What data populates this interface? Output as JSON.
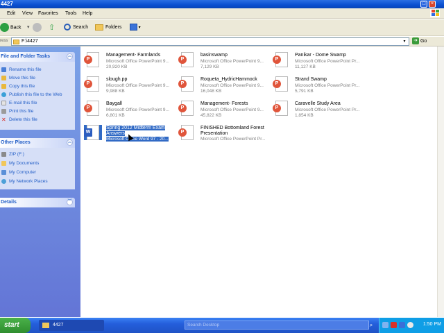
{
  "window": {
    "title": "4427"
  },
  "menu": [
    "Edit",
    "View",
    "Favorites",
    "Tools",
    "Help"
  ],
  "toolbar": {
    "back": "Back",
    "search": "Search",
    "folders": "Folders"
  },
  "address": {
    "label": "ress",
    "value": "F:\\4427",
    "go": "Go"
  },
  "file_tasks": {
    "title": "File and Folder Tasks",
    "items": [
      "Rename this file",
      "Move this file",
      "Copy this file",
      "Publish this file to the Web",
      "E-mail this file",
      "Print this file",
      "Delete this file"
    ]
  },
  "other_places": {
    "title": "Other Places",
    "items": [
      "ZIP (F:)",
      "My Documents",
      "My Computer",
      "My Network Places"
    ]
  },
  "details": {
    "title": "Details"
  },
  "files": [
    {
      "name": "Management- Farmlands",
      "type": "Microsoft Office PowerPoint 9...",
      "size": "20,920 KB",
      "kind": "ppt"
    },
    {
      "name": "basinswamp",
      "type": "Microsoft Office PowerPoint 9...",
      "size": "7,129 KB",
      "kind": "ppt"
    },
    {
      "name": "Panikar - Dome Swamp",
      "type": "Microsoft Office PowerPoint Pr...",
      "size": "11,127 KB",
      "kind": "ppt"
    },
    {
      "name": "slough.pp",
      "type": "Microsoft Office PowerPoint 9...",
      "size": "9,988 KB",
      "kind": "ppt"
    },
    {
      "name": "Roqueta_HydricHammock",
      "type": "Microsoft Office PowerPoint 9...",
      "size": "16,048 KB",
      "kind": "ppt"
    },
    {
      "name": "Strand Swamp",
      "type": "Microsoft Office PowerPoint Pr...",
      "size": "5,791 KB",
      "kind": "ppt"
    },
    {
      "name": "Baygall",
      "type": "Microsoft Office PowerPoint 9...",
      "size": "6,801 KB",
      "kind": "ppt"
    },
    {
      "name": "Management- Forests",
      "type": "Microsoft Office PowerPoint 9...",
      "size": "45,822 KB",
      "kind": "ppt"
    },
    {
      "name": "Caravelle Study Area",
      "type": "Microsoft Office PowerPoint Pr...",
      "size": "1,854 KB",
      "kind": "ppt"
    },
    {
      "name": "Spring 2012 Midterm Exam",
      "name2": "Answers",
      "type": "Microsoft Office Word 97 - 20...",
      "size": "",
      "kind": "doc",
      "selected": true
    },
    {
      "name": "FINISHED Bottomland Forest",
      "name2": "Presentation",
      "type": "Microsoft Office PowerPoint Pr...",
      "size": "",
      "kind": "ppt"
    }
  ],
  "taskbar": {
    "start": "start",
    "window_button": "4427",
    "search_placeholder": "Search Desktop",
    "clock": "1:50 PM"
  },
  "colors": {
    "titlebar": "#0a4fd0",
    "selection": "#316ac5",
    "panel_link": "#215dc6",
    "start_green": "#2f8e2f"
  }
}
